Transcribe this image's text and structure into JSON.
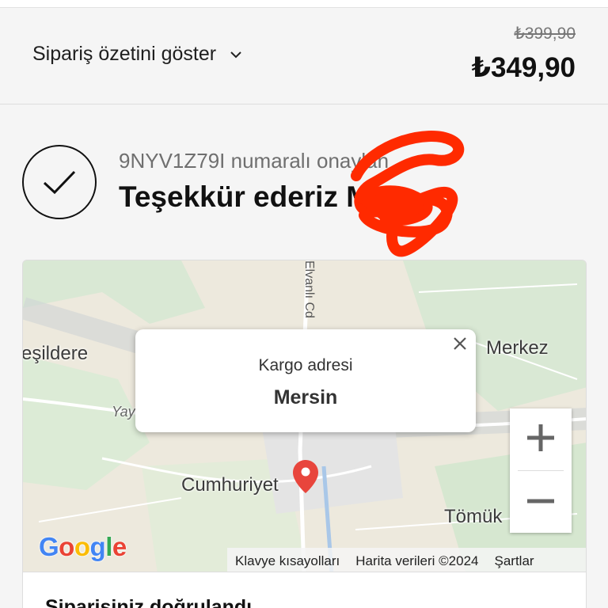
{
  "order_summary": {
    "toggle_label": "Sipariş özetini göster",
    "old_price": "₺399,90",
    "price": "₺349,90"
  },
  "confirmation": {
    "subtitle": "9NYV1Z79I numaralı onaylan",
    "title": "Teşekkür ederiz M"
  },
  "map": {
    "places": [
      "eşildere",
      "Merkez",
      "Cumhuriyet",
      "Tömük",
      "Yay"
    ],
    "road": "Elvanlı Cd",
    "popup": {
      "title": "Kargo adresi",
      "value": "Mersin"
    },
    "attribution": [
      "Klavye kısayolları",
      "Harita verileri ©2024",
      "Şartlar"
    ],
    "logo": "Google"
  },
  "order_card": {
    "title": "Siparişiniz doğrulandı"
  },
  "colors": {
    "pin": "#e8453c",
    "redaction": "#ff2a00"
  }
}
